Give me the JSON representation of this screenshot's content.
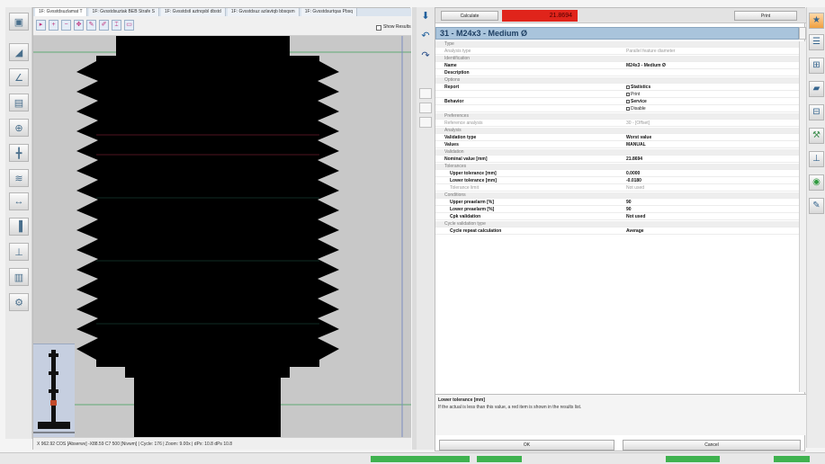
{
  "viewer": {
    "tabs": [
      "1F: Gvsstdsuzlamat T",
      "1F: Gvsstdsuztak BEB Strafe S",
      "1F: Gvsstdstl aztnqsbl dbstd",
      "1F: Gvsstdsuz azlavtqb bbsqsm",
      "1F: Gvsstdsurtqas Pbsq"
    ],
    "show_results_label": "Show Results",
    "status": "X 962.92 COS [Abserwv] -X88.59 C7 500 [Nivwm] | Cycle: 176 | Zoom: 9.00x | dPx: 10.8 dPs 10.8"
  },
  "toolbar": {
    "calculate_label": "Calculate",
    "result_value": "21.8694",
    "print_label": "Print"
  },
  "analysis": {
    "title": "31 - M24x3 - Medium Ø",
    "rows": [
      {
        "kind": "cat",
        "label": "Type",
        "value": ""
      },
      {
        "kind": "muted",
        "label": "Analysis type",
        "value": "Parallel feature diameter"
      },
      {
        "kind": "cat",
        "label": "Identification",
        "value": ""
      },
      {
        "kind": "bold",
        "label": "Name",
        "value": "M24x3 - Medium Ø"
      },
      {
        "kind": "bold",
        "label": "Description",
        "value": ""
      },
      {
        "kind": "cat",
        "label": "Options",
        "value": ""
      },
      {
        "kind": "bold",
        "label": "Report",
        "value": "Statistics"
      },
      {
        "kind": "blank",
        "label": "",
        "value": "Print"
      },
      {
        "kind": "bold",
        "label": "Behavior",
        "value": "Service"
      },
      {
        "kind": "blank",
        "label": "",
        "value": "Disable"
      },
      {
        "kind": "cat",
        "label": "Preferences",
        "value": ""
      },
      {
        "kind": "muted",
        "label": "Reference analysis",
        "value": "30 - [Offset]"
      },
      {
        "kind": "cat",
        "label": "Analysis",
        "value": ""
      },
      {
        "kind": "bold",
        "label": "Validation type",
        "value": "Worst value"
      },
      {
        "kind": "bold",
        "label": "Values",
        "value": "MANUAL"
      },
      {
        "kind": "cat",
        "label": "Validation",
        "value": ""
      },
      {
        "kind": "bold",
        "label": "Nominal value [mm]",
        "value": "21.8694"
      },
      {
        "kind": "cat",
        "label": "Tolerances",
        "value": ""
      },
      {
        "kind": "boldsub",
        "label": "Upper tolerance [mm]",
        "value": "0.0000"
      },
      {
        "kind": "boldsub",
        "label": "Lower tolerance [mm]",
        "value": "-0.0180"
      },
      {
        "kind": "mutedsub",
        "label": "Tolerance limit",
        "value": "Not used"
      },
      {
        "kind": "cat",
        "label": "Conditions",
        "value": ""
      },
      {
        "kind": "boldsub",
        "label": "Upper preaelarm [%]",
        "value": "90"
      },
      {
        "kind": "boldsub",
        "label": "Lower preaelarm [%]",
        "value": "90"
      },
      {
        "kind": "boldsub",
        "label": "Cpk validation",
        "value": "Not used"
      },
      {
        "kind": "cat",
        "label": "Cycle validation type",
        "value": ""
      },
      {
        "kind": "boldsub",
        "label": "Cycle repeat calculation",
        "value": "Average"
      }
    ],
    "description_title": "Lower tolerance [mm]",
    "description_text": "If the actual is less than this value, a red item is shown in the results list.",
    "ok_label": "OK",
    "cancel_label": "Cancel"
  },
  "icons": {
    "left_toolbar": [
      "select-icon",
      "profile-icon",
      "angle-icon",
      "measure-icon",
      "zoom-icon",
      "center-icon",
      "thread-icon",
      "distance-icon",
      "edge-icon",
      "width-icon",
      "align-icon",
      "settings-icon"
    ],
    "nav": [
      "nav-down-icon",
      "nav-back-icon",
      "nav-refresh-icon"
    ],
    "right_toolbar": [
      "new-analysis-icon",
      "list-icon",
      "add-icon",
      "folder-icon",
      "open-icon",
      "wrench-icon",
      "probe-icon",
      "target-icon",
      "pen-icon"
    ]
  },
  "colors": {
    "result_bg": "#e0241b",
    "title_bg": "#a9c4dc",
    "part_fill": "#000000",
    "canvas_bg": "#c8c8c8"
  }
}
